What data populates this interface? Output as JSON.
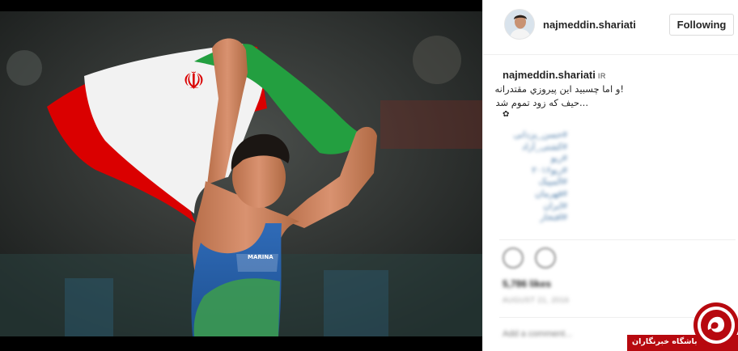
{
  "post": {
    "username": "najmeddin.shariati",
    "follow_label": "Following",
    "caption": {
      "username": "najmeddin.shariati",
      "country": "IR",
      "lines": [
        "!و اما چسبید این پیروزي مقتدرانه",
        "...حیف که زود تموم شد",
        "✿"
      ],
      "hashtags": [
        "#حسن_یزدانی",
        "#کشتی_آزاد",
        "#ریو",
        "#ریو۲۰۱۶",
        "#المپیک",
        "#قهرمان",
        "#ایران",
        "#افتخار"
      ]
    },
    "likes_text": "5,786 likes",
    "timestamp": "AUGUST 21, 2016",
    "comment_placeholder": "Add a comment..."
  },
  "photo": {
    "jersey_text": "MARINA",
    "flag_colors": {
      "green": "#239f40",
      "white": "#ffffff",
      "red": "#da0000"
    }
  },
  "watermark": {
    "label": "باشگاه خبرنگاران",
    "brand_color": "#b7090f"
  },
  "icons": [
    "heart-icon",
    "comment-icon",
    "flower-icon",
    "emblem-icon"
  ]
}
